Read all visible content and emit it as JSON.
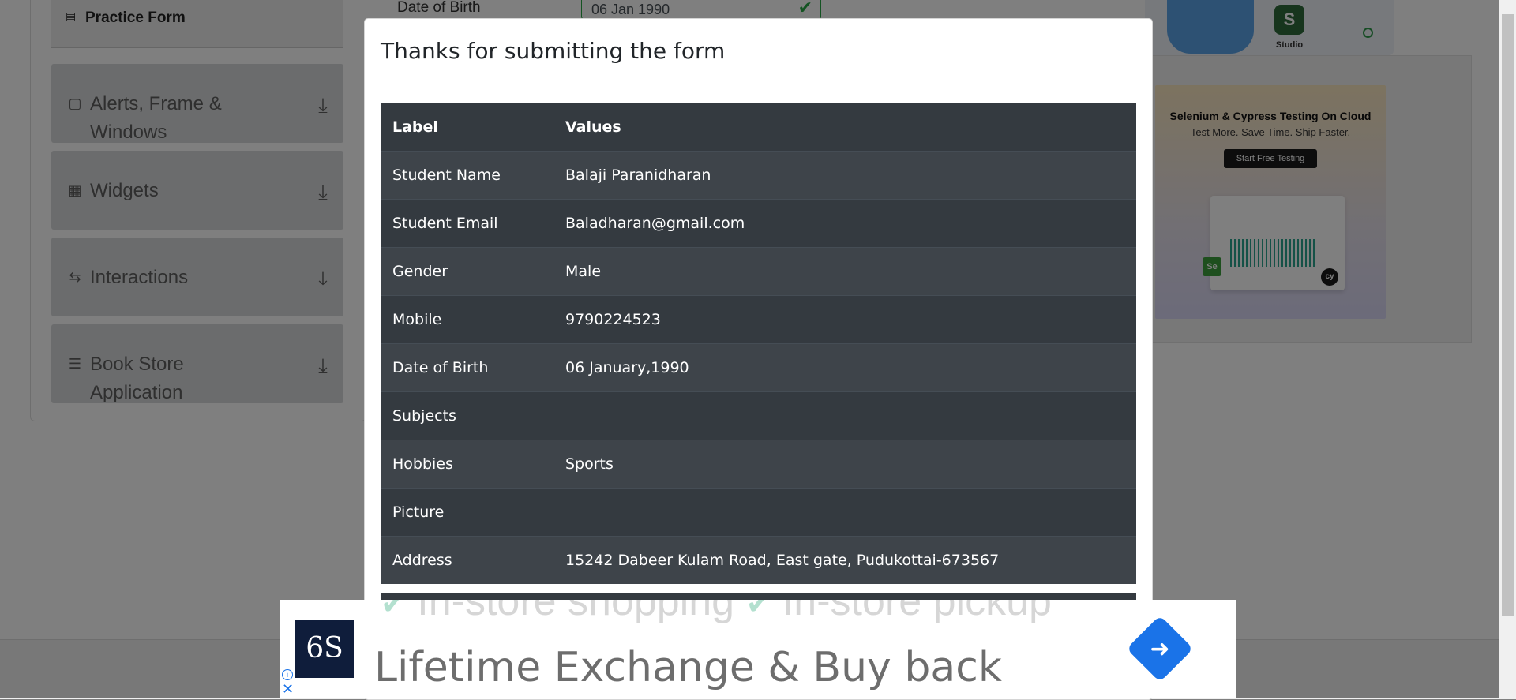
{
  "sidebar": {
    "practice_form": "Practice Form",
    "groups": [
      {
        "label": "Alerts, Frame & Windows",
        "icon": "window-icon"
      },
      {
        "label": "Widgets",
        "icon": "widgets-icon"
      },
      {
        "label": "Interactions",
        "icon": "interactions-icon"
      },
      {
        "label": "Book Store Application",
        "icon": "book-store-icon"
      }
    ]
  },
  "form": {
    "dob_label": "Date of Birth",
    "dob_value": "06 Jan 1990"
  },
  "right_ad": {
    "studio": "Studio",
    "title": "Selenium & Cypress Testing On Cloud",
    "subtitle": "Test More. Save Time. Ship Faster.",
    "button": "Start Free Testing"
  },
  "modal": {
    "title": "Thanks for submitting the form",
    "headers": [
      "Label",
      "Values"
    ],
    "rows": [
      {
        "label": "Student Name",
        "value": "Balaji Paranidharan"
      },
      {
        "label": "Student Email",
        "value": "Baladharan@gmail.com"
      },
      {
        "label": "Gender",
        "value": "Male"
      },
      {
        "label": "Mobile",
        "value": "9790224523"
      },
      {
        "label": "Date of Birth",
        "value": "06 January,1990"
      },
      {
        "label": "Subjects",
        "value": ""
      },
      {
        "label": "Hobbies",
        "value": "Sports"
      },
      {
        "label": "Picture",
        "value": ""
      },
      {
        "label": "Address",
        "value": "15242 Dabeer Kulam Road, East gate, Pudukottai-673567"
      }
    ]
  },
  "bottom_ad": {
    "ghost_left": "In-store shopping",
    "ghost_right": "In-store pickup",
    "headline": "Lifetime Exchange & Buy back",
    "logo_text": "6S"
  }
}
